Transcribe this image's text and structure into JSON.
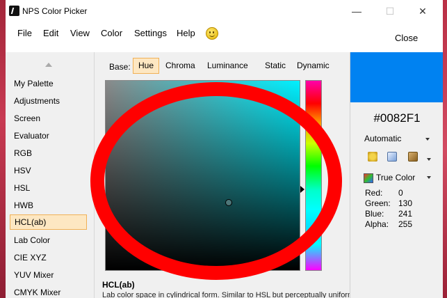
{
  "window": {
    "title": "NPS Color Picker"
  },
  "menu": {
    "items": [
      "File",
      "Edit",
      "View",
      "Color",
      "Settings",
      "Help"
    ],
    "close_label": "Close"
  },
  "sidebar": {
    "items": [
      "My Palette",
      "Adjustments",
      "Screen",
      "Evaluator",
      "RGB",
      "HSV",
      "HSL",
      "HWB",
      "HCL(ab)",
      "Lab Color",
      "CIE XYZ",
      "YUV Mixer",
      "CMYK Mixer"
    ],
    "selected": "HCL(ab)"
  },
  "main": {
    "base_label": "Base:",
    "tabs": [
      "Hue",
      "Chroma",
      "Luminance",
      "Static",
      "Dynamic"
    ],
    "active_tab": "Hue",
    "description_title": "HCL(ab)",
    "description_text": "Lab color space in cylindrical form. Similar to HSL but perceptually uniform"
  },
  "color": {
    "hex": "#0082F1",
    "swatch_color": "#0082F1",
    "mode": "Automatic",
    "color_depth": "True Color",
    "channels": [
      {
        "label": "Red:",
        "value": "0"
      },
      {
        "label": "Green:",
        "value": "130"
      },
      {
        "label": "Blue:",
        "value": "241"
      },
      {
        "label": "Alpha:",
        "value": "255"
      }
    ]
  },
  "colors": {
    "annotation_ring": "#ff0000",
    "selection_bg": "#fde7c2",
    "selection_border": "#f0b056"
  }
}
